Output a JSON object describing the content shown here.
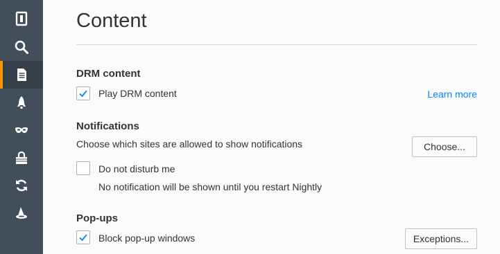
{
  "sidebar": {
    "items": [
      {
        "icon": "general-icon",
        "selected": false
      },
      {
        "icon": "search-icon",
        "selected": false
      },
      {
        "icon": "content-icon",
        "selected": true
      },
      {
        "icon": "applications-icon",
        "selected": false
      },
      {
        "icon": "privacy-mask-icon",
        "selected": false
      },
      {
        "icon": "security-lock-icon",
        "selected": false
      },
      {
        "icon": "sync-icon",
        "selected": false
      },
      {
        "icon": "advanced-wizard-hat-icon",
        "selected": false
      }
    ],
    "background": "#424f5a",
    "selected_accent": "#ff9500"
  },
  "page": {
    "title": "Content"
  },
  "drm": {
    "heading": "DRM content",
    "checkbox_label": "Play DRM content",
    "checked": true,
    "learn_more": "Learn more"
  },
  "notifications": {
    "heading": "Notifications",
    "description": "Choose which sites are allowed to show notifications",
    "choose_button": "Choose...",
    "dnd_label": "Do not disturb me",
    "dnd_checked": false,
    "dnd_note": "No notification will be shown until you restart Nightly"
  },
  "popups": {
    "heading": "Pop-ups",
    "checkbox_label": "Block pop-up windows",
    "checked": true,
    "exceptions_button": "Exceptions..."
  },
  "colors": {
    "accent_link": "#0a84ff",
    "check": "#0a84ff"
  }
}
